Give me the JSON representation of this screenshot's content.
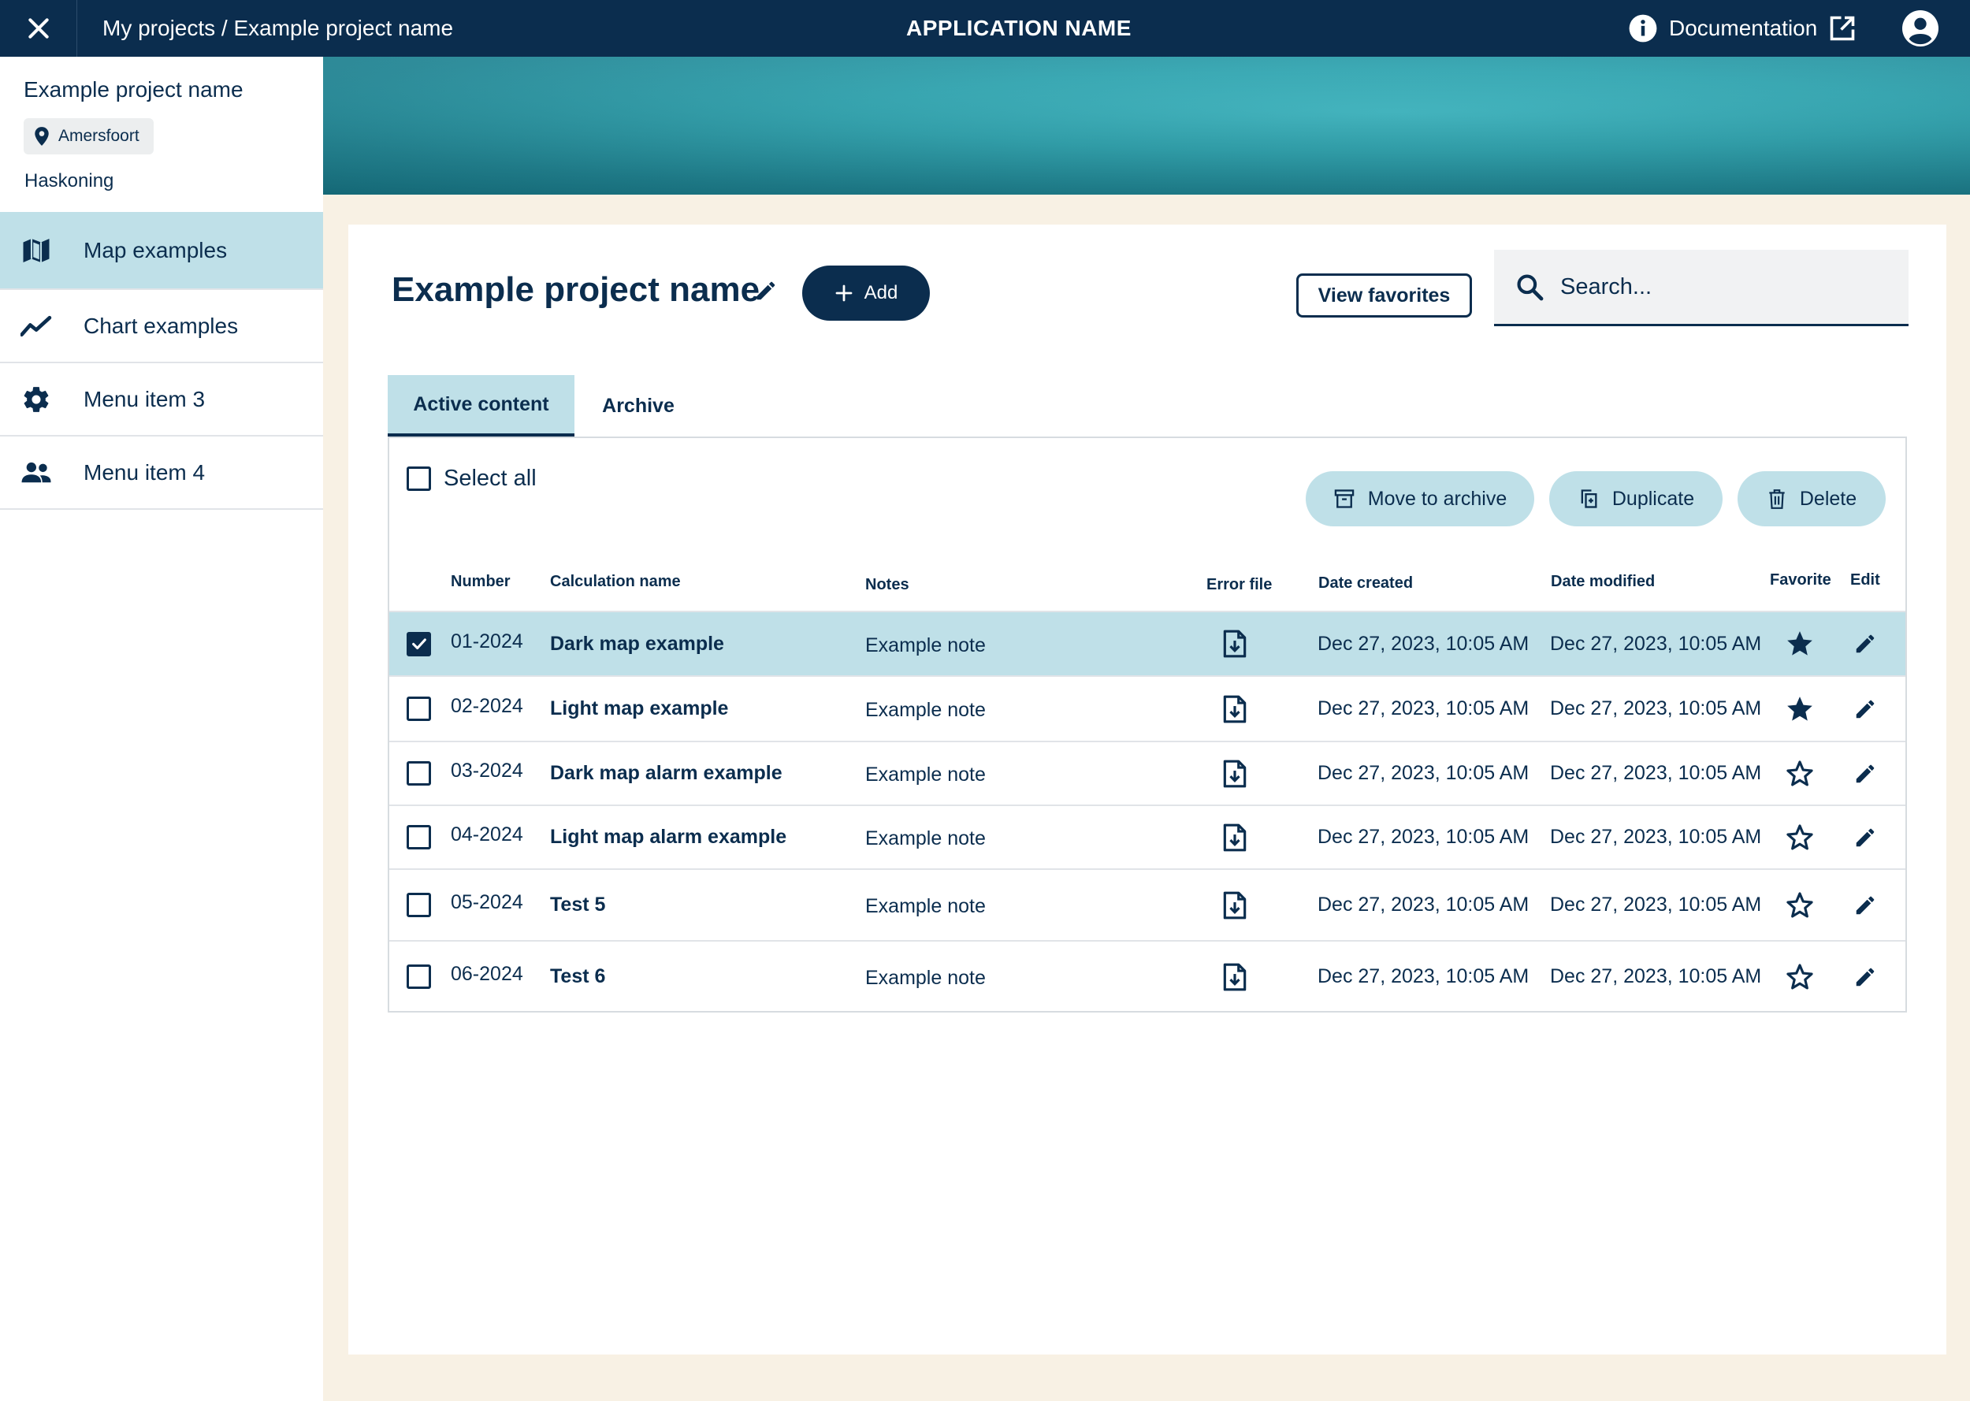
{
  "topbar": {
    "breadcrumb": "My projects / Example project name",
    "app_name": "APPLICATION NAME",
    "doc_label": "Documentation",
    "icons": [
      "close-icon",
      "info-icon",
      "external-link-icon",
      "account-icon"
    ]
  },
  "sidebar": {
    "project_name": "Example project name",
    "location": "Amersfoort",
    "company": "Haskoning",
    "items": [
      {
        "label": "Map examples",
        "icon": "map-icon",
        "active": true
      },
      {
        "label": "Chart examples",
        "icon": "chart-line-icon",
        "active": false
      },
      {
        "label": "Menu item 3",
        "icon": "gear-icon",
        "active": false
      },
      {
        "label": "Menu item 4",
        "icon": "people-icon",
        "active": false
      }
    ]
  },
  "main": {
    "title": "Example project name",
    "add_label": "Add",
    "view_favorites_label": "View favorites",
    "search_placeholder": "Search...",
    "tabs": [
      {
        "label": "Active content",
        "active": true
      },
      {
        "label": "Archive",
        "active": false
      }
    ],
    "select_all_label": "Select all",
    "actions": {
      "archive": "Move to archive",
      "duplicate": "Duplicate",
      "delete": "Delete"
    },
    "columns": {
      "number": "Number",
      "name": "Calculation name",
      "notes": "Notes",
      "error_file": "Error file",
      "created": "Date created",
      "modified": "Date modified",
      "favorite": "Favorite",
      "edit": "Edit"
    },
    "rows": [
      {
        "checked": true,
        "number": "01-2024",
        "name": "Dark map example",
        "notes": "Example note",
        "created": "Dec 27, 2023, 10:05 AM",
        "modified": "Dec 27, 2023, 10:05 AM",
        "favorite": true
      },
      {
        "checked": false,
        "number": "02-2024",
        "name": "Light map example",
        "notes": "Example note",
        "created": "Dec 27, 2023, 10:05 AM",
        "modified": "Dec 27, 2023, 10:05 AM",
        "favorite": true
      },
      {
        "checked": false,
        "number": "03-2024",
        "name": "Dark map alarm example",
        "notes": "Example note",
        "created": "Dec 27, 2023, 10:05 AM",
        "modified": "Dec 27, 2023, 10:05 AM",
        "favorite": false
      },
      {
        "checked": false,
        "number": "04-2024",
        "name": "Light map alarm example",
        "notes": "Example note",
        "created": "Dec 27, 2023, 10:05 AM",
        "modified": "Dec 27, 2023, 10:05 AM",
        "favorite": false
      },
      {
        "checked": false,
        "number": "05-2024",
        "name": "Test 5",
        "notes": "Example note",
        "created": "Dec 27, 2023, 10:05 AM",
        "modified": "Dec 27, 2023, 10:05 AM",
        "favorite": false
      },
      {
        "checked": false,
        "number": "06-2024",
        "name": "Test 6",
        "notes": "Example note",
        "created": "Dec 27, 2023, 10:05 AM",
        "modified": "Dec 27, 2023, 10:05 AM",
        "favorite": false
      }
    ]
  },
  "colors": {
    "navy": "#0b2d4e",
    "light_teal": "#bfe0e8",
    "cream": "#f8f1e4",
    "hero_teal": "#2ea6b2"
  }
}
